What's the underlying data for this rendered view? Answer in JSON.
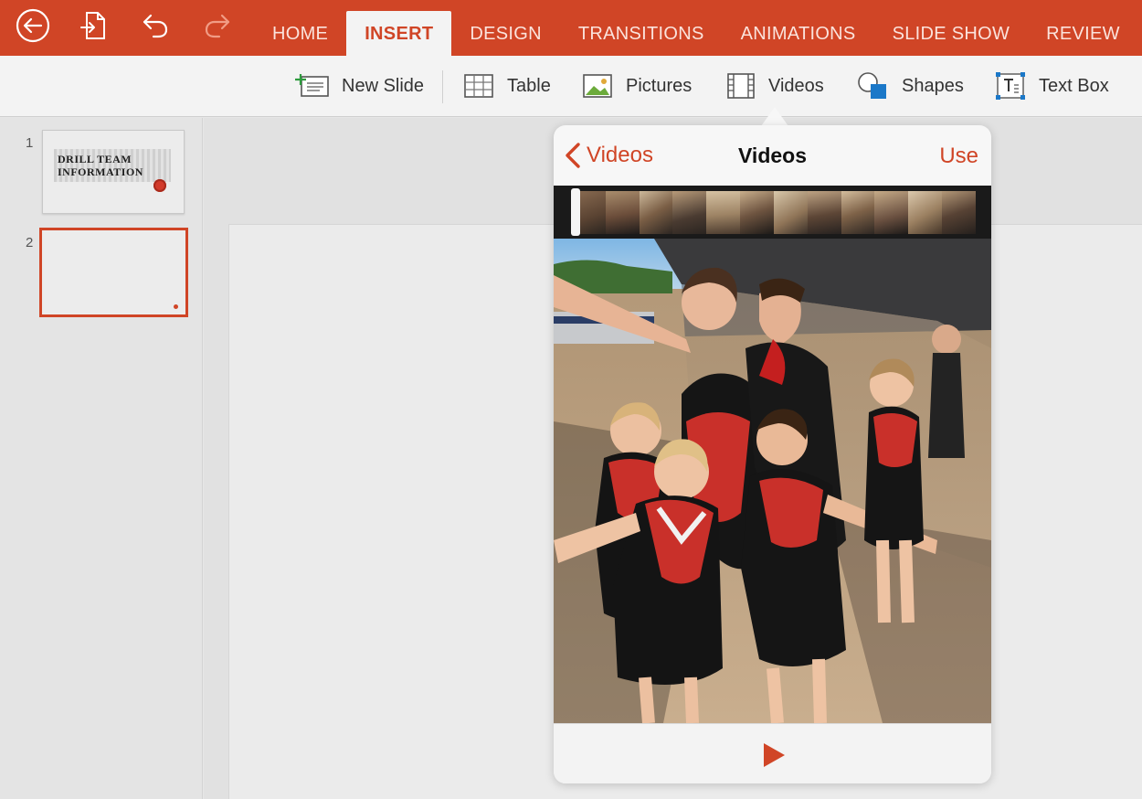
{
  "toolbar": {
    "back_icon": "back-circle-icon",
    "file_icon": "file-export-icon",
    "undo_icon": "undo-icon",
    "redo_icon": "redo-icon"
  },
  "tabs": [
    {
      "label": "HOME",
      "active": false
    },
    {
      "label": "INSERT",
      "active": true
    },
    {
      "label": "DESIGN",
      "active": false
    },
    {
      "label": "TRANSITIONS",
      "active": false
    },
    {
      "label": "ANIMATIONS",
      "active": false
    },
    {
      "label": "SLIDE SHOW",
      "active": false
    },
    {
      "label": "REVIEW",
      "active": false
    }
  ],
  "ribbon": {
    "new_slide": "New Slide",
    "table": "Table",
    "pictures": "Pictures",
    "videos": "Videos",
    "shapes": "Shapes",
    "text_box": "Text Box"
  },
  "slides": [
    {
      "number": "1",
      "title_line1": "DRILL TEAM",
      "title_line2": "INFORMATION"
    },
    {
      "number": "2"
    }
  ],
  "popover": {
    "back_label": "Videos",
    "title": "Videos",
    "use_label": "Use",
    "play_icon": "play-icon"
  },
  "colors": {
    "accent": "#d04526",
    "ribbon_bg": "#f3f3f3",
    "canvas_bg": "#e1e1e1"
  }
}
